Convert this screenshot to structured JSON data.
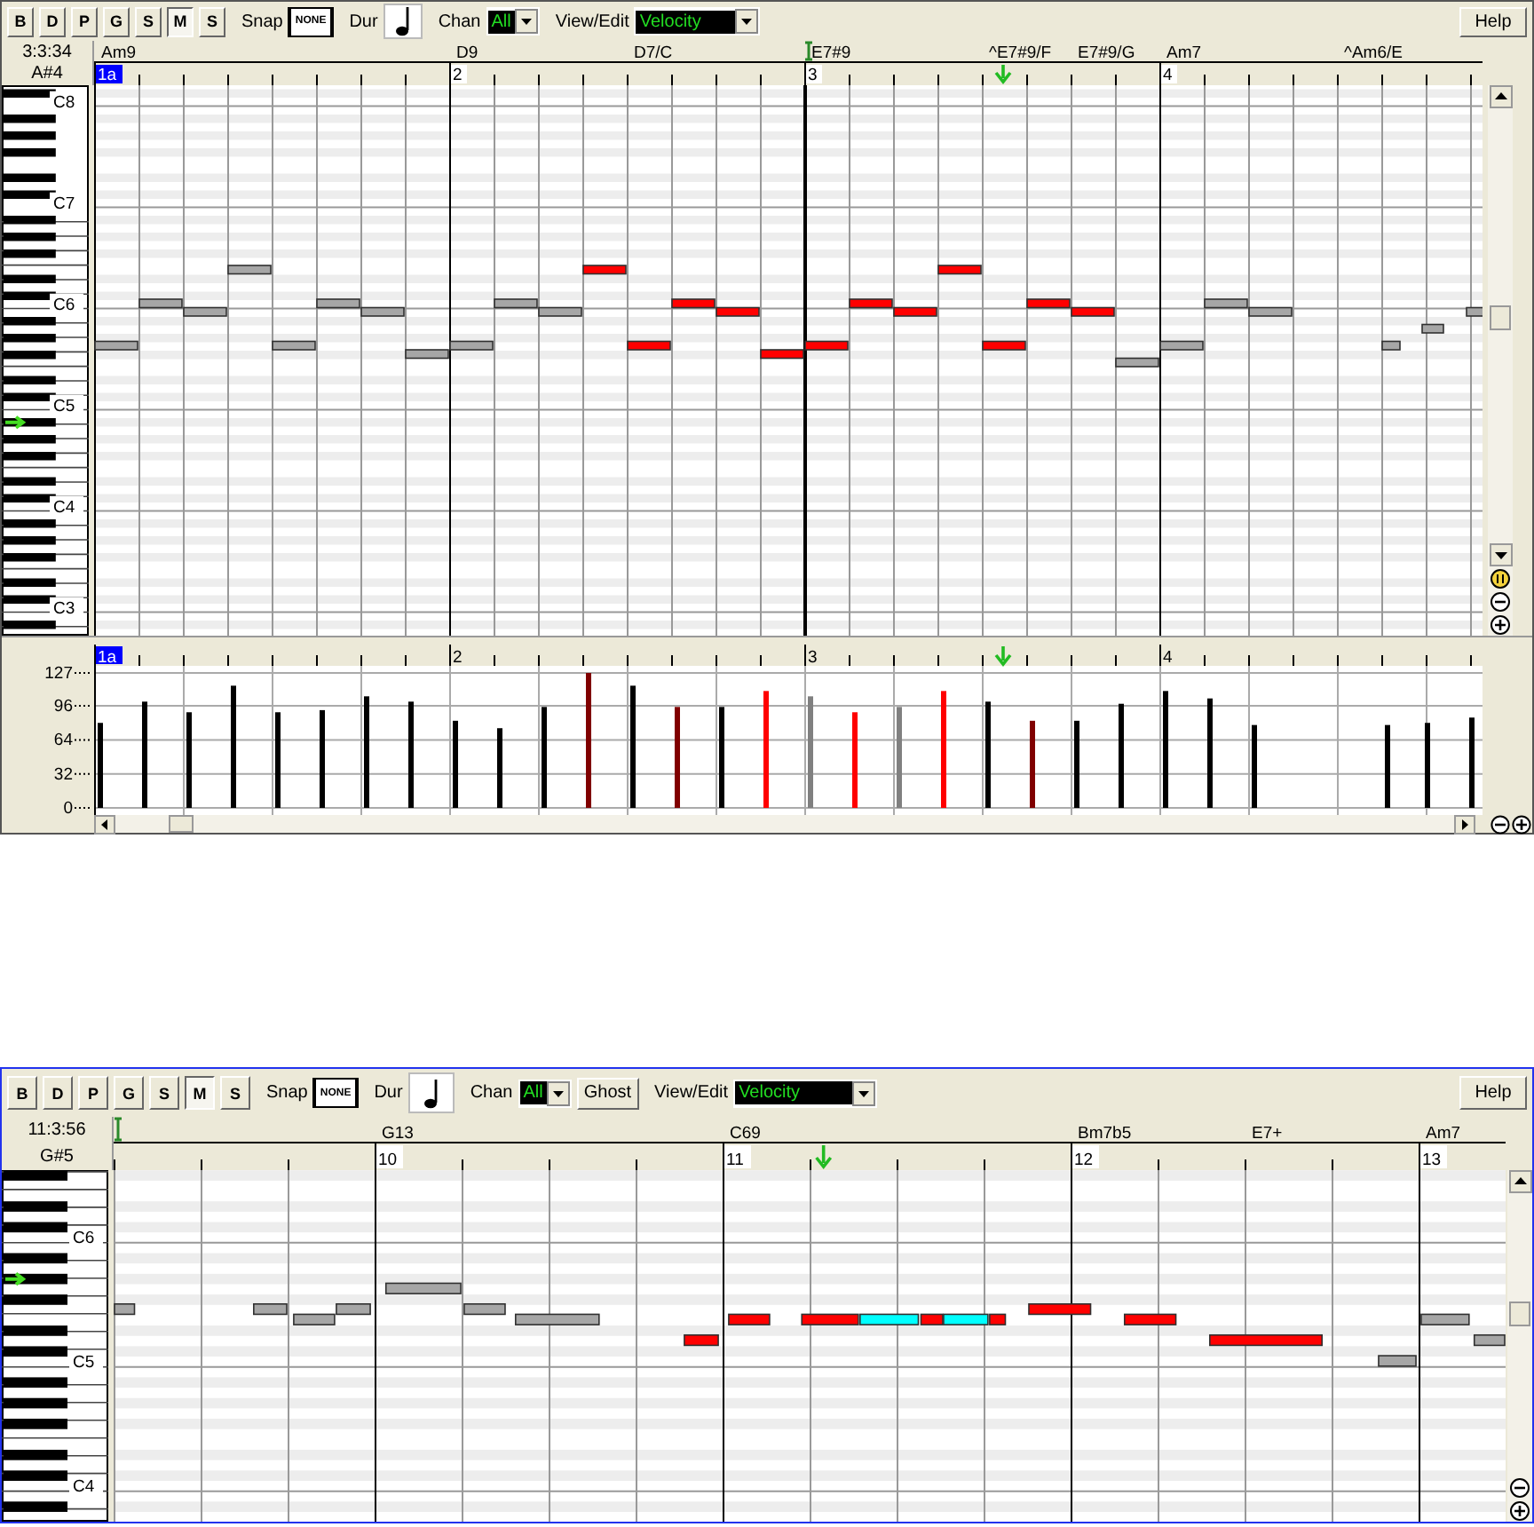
{
  "windows": [
    {
      "active": false,
      "toolbar": {
        "buttons": [
          {
            "label": "B",
            "selected": false
          },
          {
            "label": "D",
            "selected": false
          },
          {
            "label": "P",
            "selected": false
          },
          {
            "label": "G",
            "selected": false
          },
          {
            "label": "S",
            "selected": false
          },
          {
            "label": "M",
            "selected": true
          },
          {
            "label": "S",
            "selected": false
          }
        ],
        "snap_label": "Snap",
        "snap_value": "NONE",
        "dur_label": "Dur",
        "chan_label": "Chan",
        "chan_value": "All",
        "view_edit_label": "View/Edit",
        "view_edit_value": "Velocity",
        "help_button": "Help"
      },
      "position": "3:3:34",
      "pitch": "A#4",
      "chords": [
        "Am9",
        "D9",
        "D7/C",
        "E7#9",
        "^E7#9/F",
        "E7#9/G",
        "Am7",
        "^Am6/E"
      ],
      "measure_numbers": [
        {
          "label": "1a",
          "selected": true
        },
        {
          "label": "2",
          "selected": false
        },
        {
          "label": "3",
          "selected": false
        },
        {
          "label": "4",
          "selected": false
        }
      ],
      "octave_labels": [
        "C8",
        "C7",
        "C6",
        "C5",
        "C4",
        "C3"
      ],
      "notes": [
        {
          "color": "#a6a6a6"
        },
        {
          "color": "#a6a6a6"
        },
        {
          "color": "#a6a6a6"
        },
        {
          "color": "#a6a6a6"
        },
        {
          "color": "#a6a6a6"
        },
        {
          "color": "#a6a6a6"
        },
        {
          "color": "#a6a6a6"
        },
        {
          "color": "#a6a6a6"
        },
        {
          "color": "#a6a6a6"
        },
        {
          "color": "#a6a6a6"
        },
        {
          "color": "#a6a6a6"
        },
        {
          "color": "#ff0000"
        },
        {
          "color": "#ff0000"
        },
        {
          "color": "#ff0000"
        },
        {
          "color": "#ff0000"
        },
        {
          "color": "#ff0000"
        },
        {
          "color": "#ff0000"
        },
        {
          "color": "#ff0000"
        },
        {
          "color": "#ff0000"
        },
        {
          "color": "#ff0000"
        },
        {
          "color": "#ff0000"
        },
        {
          "color": "#ff0000"
        },
        {
          "color": "#ff0000"
        },
        {
          "color": "#a6a6a6"
        },
        {
          "color": "#a6a6a6"
        },
        {
          "color": "#a6a6a6"
        },
        {
          "color": "#a6a6a6"
        },
        {
          "color": "#a6a6a6"
        },
        {
          "color": "#a6a6a6"
        },
        {
          "color": "#a6a6a6"
        }
      ],
      "velocity_panel": {
        "tick_states": [
          {
            "selected": true
          },
          {
            "selected": false
          },
          {
            "selected": false
          },
          {
            "selected": false
          }
        ],
        "chart_data": {
          "type": "bar",
          "x": [
            1,
            1.125,
            1.25,
            1.375,
            1.5,
            1.625,
            1.75,
            1.875,
            2,
            2.125,
            2.25,
            2.375,
            2.5,
            2.625,
            2.75,
            2.875,
            3,
            3.125,
            3.25,
            3.375,
            3.5,
            3.625,
            3.75,
            3.875,
            4,
            4.125,
            4.25,
            4.625,
            4.7375,
            4.8625
          ],
          "xlim": [
            1,
            4.91
          ],
          "grid": true,
          "xticks": [
            {
              "value": 1,
              "label": "1a"
            },
            {
              "value": 2,
              "label": "2"
            },
            {
              "value": 3,
              "label": "3"
            },
            {
              "value": 4,
              "label": "4"
            }
          ],
          "ylim": [
            0,
            127
          ],
          "yticks": [
            {
              "value": 0,
              "label": "0"
            },
            {
              "value": 32,
              "label": "32"
            },
            {
              "value": 64,
              "label": "64"
            },
            {
              "value": 96,
              "label": "96"
            },
            {
              "value": 127,
              "label": "127"
            }
          ],
          "series": [
            {
              "color": "#000000",
              "values": [
                80,
                100,
                90,
                115,
                90,
                92,
                105,
                100,
                82,
                75,
                95,
                null,
                115,
                null,
                95,
                null,
                null,
                null,
                null,
                null,
                100,
                null,
                82,
                98,
                110,
                103,
                78,
                78,
                80,
                85
              ]
            },
            {
              "color": "#800000",
              "values": [
                null,
                null,
                null,
                null,
                null,
                null,
                null,
                null,
                null,
                null,
                null,
                127,
                null,
                95,
                null,
                null,
                null,
                null,
                null,
                null,
                null,
                82,
                null,
                null,
                null,
                null,
                null,
                null,
                null,
                null
              ]
            },
            {
              "color": "#ff0000",
              "values": [
                null,
                null,
                null,
                null,
                null,
                null,
                null,
                null,
                null,
                null,
                null,
                null,
                null,
                null,
                null,
                110,
                null,
                90,
                null,
                110,
                null,
                null,
                null,
                null,
                null,
                null,
                null,
                null,
                null,
                null
              ]
            },
            {
              "color": "#808080",
              "values": [
                null,
                null,
                null,
                null,
                null,
                null,
                null,
                null,
                null,
                null,
                null,
                null,
                null,
                null,
                null,
                null,
                105,
                null,
                95,
                null,
                null,
                null,
                null,
                null,
                null,
                null,
                null,
                null,
                null,
                null
              ]
            }
          ]
        }
      }
    },
    {
      "active": true,
      "toolbar": {
        "buttons": [
          {
            "label": "B",
            "selected": false
          },
          {
            "label": "D",
            "selected": false
          },
          {
            "label": "P",
            "selected": false
          },
          {
            "label": "G",
            "selected": false
          },
          {
            "label": "S",
            "selected": false
          },
          {
            "label": "M",
            "selected": true
          },
          {
            "label": "S",
            "selected": false
          }
        ],
        "snap_label": "Snap",
        "snap_value": "NONE",
        "dur_label": "Dur",
        "chan_label": "Chan",
        "chan_value": "All",
        "ghost_button": "Ghost",
        "view_edit_label": "View/Edit",
        "view_edit_value": "Velocity",
        "help_button": "Help"
      },
      "position": "11:3:56",
      "pitch": "G#5",
      "chords": [
        "G13",
        "C69",
        "Bm7b5",
        "E7+",
        "Am7"
      ],
      "measure_numbers": [
        {
          "label": "10",
          "selected": false
        },
        {
          "label": "11",
          "selected": false
        },
        {
          "label": "12",
          "selected": false
        },
        {
          "label": "13",
          "selected": false
        }
      ],
      "octave_labels": [
        "C6",
        "C5",
        "C4"
      ],
      "notes": [
        {
          "color": "#a6a6a6"
        },
        {
          "color": "#a6a6a6"
        },
        {
          "color": "#a6a6a6"
        },
        {
          "color": "#a6a6a6"
        },
        {
          "color": "#a6a6a6"
        },
        {
          "color": "#a6a6a6"
        },
        {
          "color": "#a6a6a6"
        },
        {
          "color": "#ff0000"
        },
        {
          "color": "#ff0000"
        },
        {
          "color": "#ff0000"
        },
        {
          "color": "#00ffff"
        },
        {
          "color": "#ff0000"
        },
        {
          "color": "#00ffff"
        },
        {
          "color": "#ff0000"
        },
        {
          "color": "#ff0000"
        },
        {
          "color": "#ff0000"
        },
        {
          "color": "#ff0000"
        },
        {
          "color": "#a6a6a6"
        },
        {
          "color": "#a6a6a6"
        },
        {
          "color": "#a6a6a6"
        }
      ]
    }
  ]
}
